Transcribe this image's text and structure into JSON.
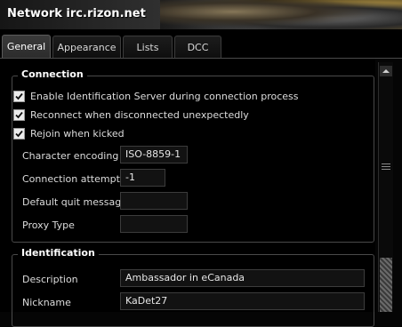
{
  "window": {
    "title": "Network irc.rizon.net"
  },
  "tabs": [
    {
      "label": "General",
      "active": true
    },
    {
      "label": "Appearance",
      "active": false
    },
    {
      "label": "Lists",
      "active": false
    },
    {
      "label": "DCC",
      "active": false
    }
  ],
  "connection": {
    "title": "Connection",
    "checkboxes": [
      {
        "label": "Enable Identification Server during connection process",
        "checked": true
      },
      {
        "label": "Reconnect when disconnected unexpectedly",
        "checked": true
      },
      {
        "label": "Rejoin when kicked",
        "checked": true
      }
    ],
    "fields": [
      {
        "label": "Character encoding",
        "value": "ISO-8859-1"
      },
      {
        "label": "Connection attempts",
        "value": "-1"
      },
      {
        "label": "Default quit message",
        "value": ""
      },
      {
        "label": "Proxy Type",
        "value": ""
      }
    ]
  },
  "identification": {
    "title": "Identification",
    "fields": [
      {
        "label": "Description",
        "value": "Ambassador in eCanada"
      },
      {
        "label": "Nickname",
        "value": "KaDet27"
      }
    ]
  },
  "icons": {
    "scroll_up": "chevron-up-icon",
    "check": "check-icon"
  }
}
